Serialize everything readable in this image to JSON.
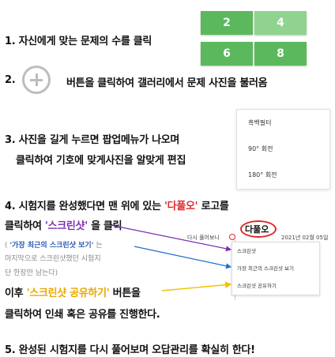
{
  "steps": {
    "s1": "1. 자신에게 맞는 문제의 수를 클릭",
    "s2": "2.",
    "s2_rest": "버튼을 클릭하여 갤러리에서 문제 사진을 불러옴",
    "s3_l1": "3. 사진을 길게 누르면 팝업메뉴가 나오며",
    "s3_l2": "클릭하여 기호에 맞게사진을 알맞게 편집",
    "s4_l1_a": "4. 시험지를 완성했다면 맨 위에 있는",
    "s4_l1_b": "'다풀오'",
    "s4_l1_c": "로고를",
    "s4_l2_a": "클릭하여",
    "s4_l2_b": "'스크린샷'",
    "s4_l2_c": "을 클릭",
    "note_l1_a": "(",
    "note_l1_b": "'가장 최근의 스크린샷 보기'",
    "note_l1_c": "는",
    "note_l2": "마지막으로 스크린샷했던 시험지",
    "note_l3": "단 한장만 남는다)",
    "s4_l3_a": "이후",
    "s4_l3_b": "'스크린샷 공유하기'",
    "s4_l3_c": "버튼을",
    "s4_l4": "클릭하여 인쇄 혹은 공유를 진행한다.",
    "s5": "5. 완성된 시험지를 다시 풀어보며 오답관리를 확실히 한다!"
  },
  "grid": [
    "2",
    "4",
    "6",
    "8"
  ],
  "edit_menu": [
    "흑백필터",
    "90° 회전",
    "180° 회전"
  ],
  "app": {
    "prev_label": "다시 풀어보니",
    "logo": "다풀오",
    "date": "2021년 02월 05일",
    "menu": [
      "스크린샷",
      "가장 최근의 스크린샷 보기",
      "스크린샷 공유하기"
    ]
  },
  "colors": {
    "tile_green": "#5cb85c",
    "accent_red": "#e0282c",
    "purple": "#7b2fb0",
    "gold": "#e9a700",
    "blue": "#2b5fb3"
  }
}
